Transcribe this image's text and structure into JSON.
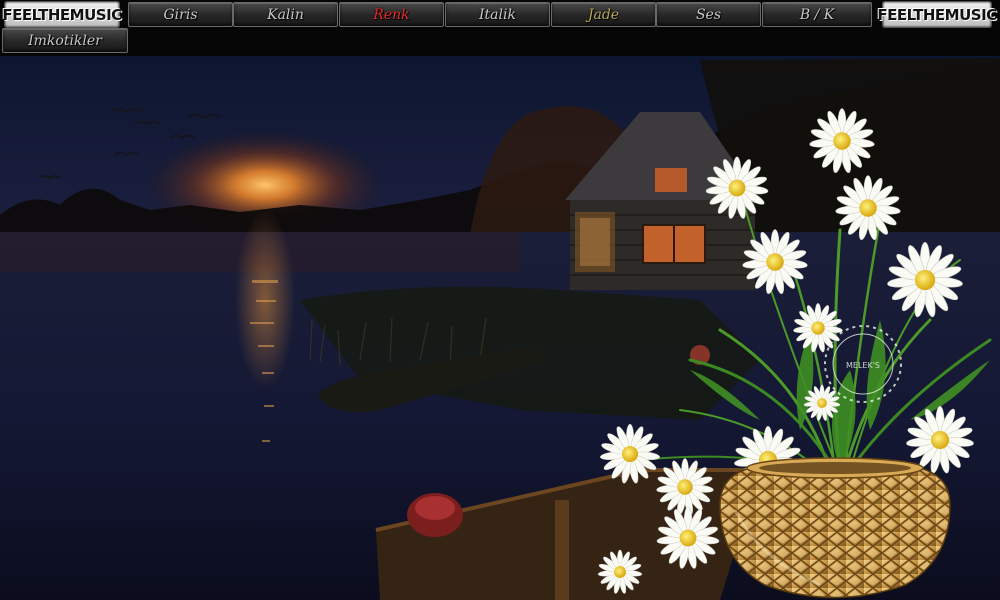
{
  "nav": {
    "logo_left": "FEELTHEMUSIC",
    "logo_right": "FEELTHEMUSIC",
    "items": [
      {
        "label": "Giris"
      },
      {
        "label": "Kalin"
      },
      {
        "label": "Renk"
      },
      {
        "label": "Italik"
      },
      {
        "label": "Jade"
      },
      {
        "label": "Ses"
      },
      {
        "label": "B / K"
      },
      {
        "label": "Imkotikler"
      }
    ],
    "active_index": 2,
    "colors": {
      "active": "#e22b2b",
      "gold": "#b8a85a",
      "normal": "#c9c9c9"
    }
  },
  "scene": {
    "watermark": "MELEK'S",
    "icons": [
      "sunset-icon",
      "cabin-icon",
      "boat-icon",
      "daisy-icon",
      "basket-vase-icon",
      "bird-icon"
    ]
  }
}
